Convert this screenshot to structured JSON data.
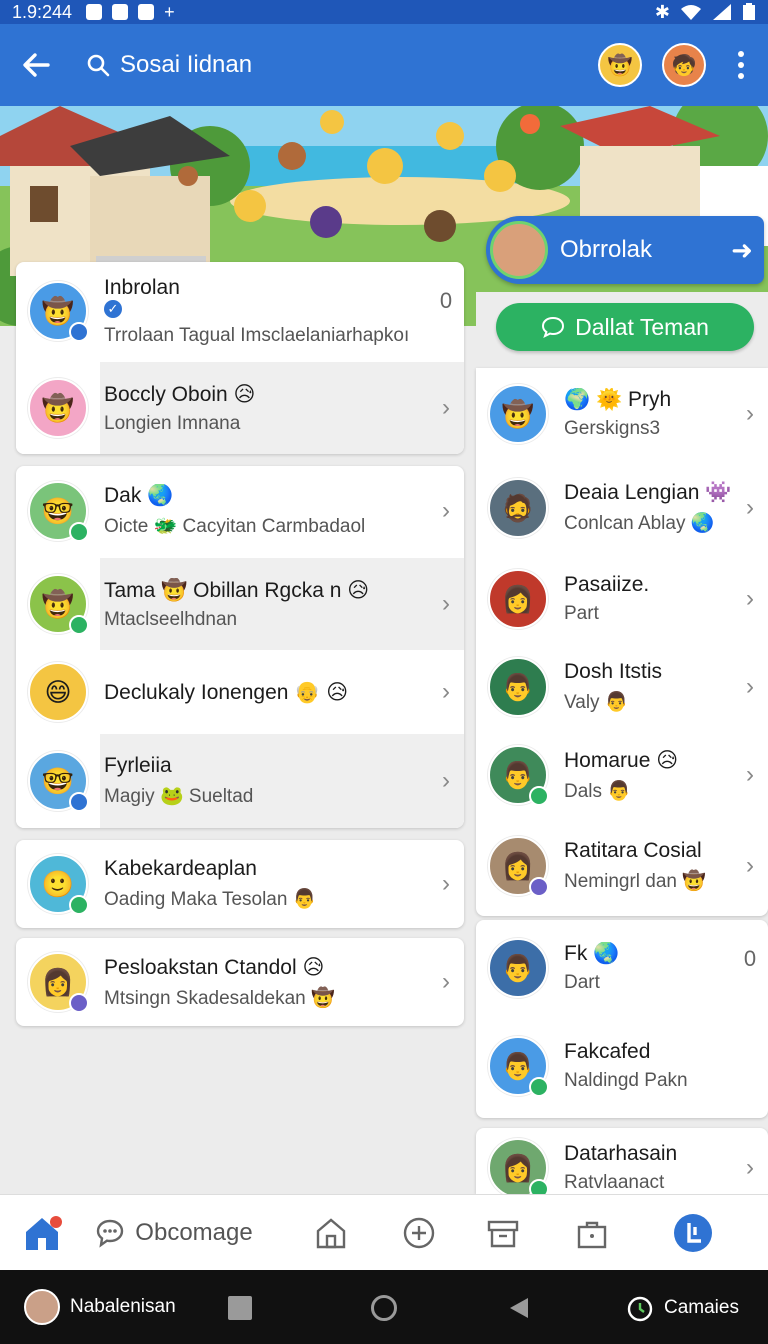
{
  "status_bar": {
    "time": "1.9:244"
  },
  "app_bar": {
    "title": "Sosai Iidnan"
  },
  "feature": {
    "label": "Obrrolak"
  },
  "friend_button": {
    "label": "Dallat Teman"
  },
  "left_list": [
    {
      "name": "Inbrolan",
      "sub": "Trrolaan Tagual Imsclaelaniarhapkoı",
      "count": "0",
      "verified": true,
      "emoji": "🤠",
      "av": "#4a9be6",
      "badge": "#2f73d3"
    },
    {
      "name": "Boccly Oboin 😥",
      "sub": "Longien Imnana",
      "emoji": "🤠",
      "av": "#f3a6c6",
      "badge": ""
    },
    {
      "name": "Dak 🌏",
      "sub": "Oicte 🐲 Cacyitan Carmbadaol",
      "emoji": "🤓",
      "av": "#7ac47a",
      "badge": "#2cb262"
    },
    {
      "name": "Tama 🤠 Obillan Rgcka n 😥",
      "sub": "Mtaclseelhdnan",
      "emoji": "🤠",
      "av": "#8bc34a",
      "badge": "#2cb262"
    },
    {
      "name": "Declukaly Ionengen 👴 😥",
      "sub": "",
      "emoji": "😄",
      "av": "#f4c542",
      "badge": ""
    },
    {
      "name": "Fyrleiia",
      "sub": "Magiy 🐸 Sueltad",
      "emoji": "🤓",
      "av": "#5aa7e0",
      "badge": "#2f73d3"
    },
    {
      "name": "Kabekardeaplan",
      "sub": "Oading Maka Tesolan 👨",
      "emoji": "🙂",
      "av": "#4fb8d8",
      "badge": "#2cb262"
    },
    {
      "name": "Pesloakstan Ctandol 😥",
      "sub": "Mtsingn Skadesaldekan 🤠",
      "emoji": "👩",
      "av": "#f4d35e",
      "badge": "#6b5fc7"
    }
  ],
  "right_list": [
    {
      "name": "🌍 🌞 Pryh",
      "sub": "Gerskigns3",
      "emoji": "🤠",
      "av": "#4a9be6",
      "badge": "",
      "right": "chev"
    },
    {
      "name": "Deaia Lengian 👾",
      "sub": "Conlcan Ablay 🌏",
      "emoji": "🧔",
      "av": "#5a6f7e",
      "badge": "",
      "right": "chev"
    },
    {
      "name": "Pasaiize.",
      "sub": "Part",
      "emoji": "👩",
      "av": "#c0392b",
      "badge": "",
      "right": "chev"
    },
    {
      "name": "Dosh Itstis",
      "sub": "Valy 👨",
      "emoji": "👨",
      "av": "#2e7d4f",
      "badge": "",
      "right": "chev"
    },
    {
      "name": "Homarue 😥",
      "sub": "Dals 👨",
      "emoji": "👨",
      "av": "#3f8a5a",
      "badge": "#2cb262",
      "right": "chev"
    },
    {
      "name": "Ratitara Cosial",
      "sub": "Nemingrl dan 🤠",
      "emoji": "👩",
      "av": "#a78b6f",
      "badge": "#6b5fc7",
      "right": "chev"
    },
    {
      "name": "Fk 🌏",
      "sub": "Dart",
      "emoji": "👨",
      "av": "#3c6ea8",
      "badge": "",
      "right": "0"
    },
    {
      "name": "Fakcafed",
      "sub": "Naldingd Pakn",
      "emoji": "👨",
      "av": "#4a9be6",
      "badge": "#2cb262",
      "right": ""
    },
    {
      "name": "Datarhasain",
      "sub": "Ratvlaanact",
      "emoji": "👩",
      "av": "#6fa86f",
      "badge": "#2cb262",
      "right": "chev"
    }
  ],
  "bottom_nav": {
    "label": "Obcomage"
  },
  "system_bar": {
    "user": "Nabalenisan",
    "right_label": "Camaies"
  },
  "colors": {
    "primary": "#2f73d3",
    "green": "#2cb262",
    "status": "#1f57b8"
  }
}
